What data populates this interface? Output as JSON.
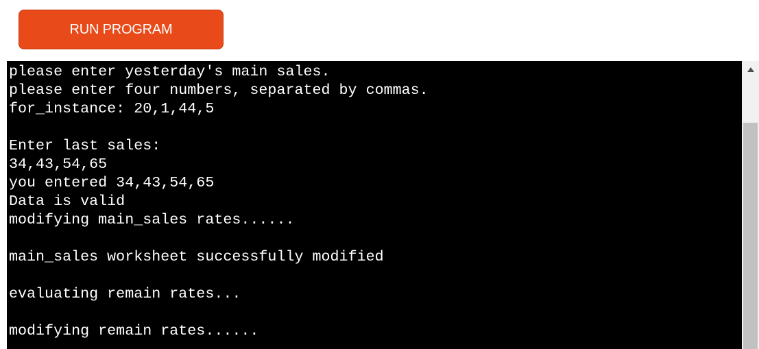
{
  "run_button": {
    "label": "RUN PROGRAM"
  },
  "terminal": {
    "lines": [
      "please enter yesterday's main sales.",
      "please enter four numbers, separated by commas.",
      "for_instance: 20,1,44,5",
      "",
      "Enter last sales:",
      "34,43,54,65",
      "you entered 34,43,54,65",
      "Data is valid",
      "modifying main_sales rates......",
      "",
      "main_sales worksheet successfully modified",
      "",
      "evaluating remain rates...",
      "",
      "modifying remain rates......"
    ]
  },
  "scrollbar": {
    "up_icon": "chevron-up-icon"
  },
  "colors": {
    "button_bg": "#e84a19",
    "terminal_bg": "#000000",
    "terminal_text": "#ffffff"
  }
}
